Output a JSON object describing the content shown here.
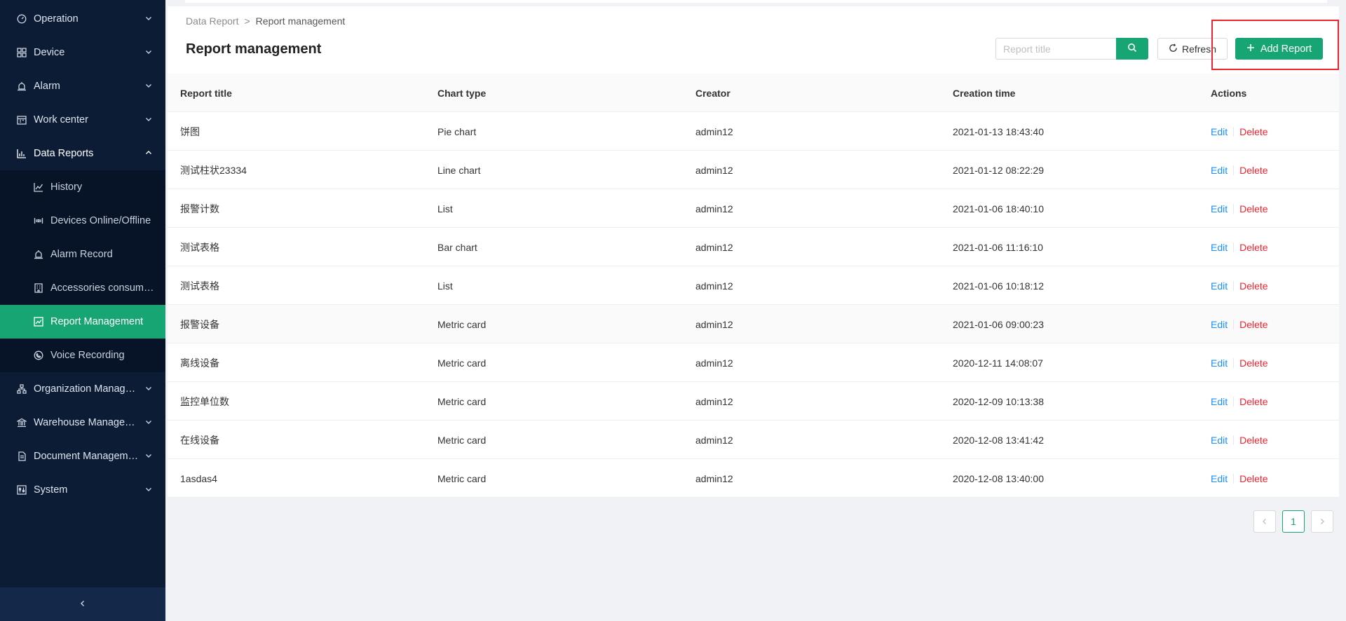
{
  "sidebar": {
    "items": [
      {
        "label": "Operation",
        "icon": "dashboard-icon"
      },
      {
        "label": "Device",
        "icon": "grid-icon"
      },
      {
        "label": "Alarm",
        "icon": "alarm-icon"
      },
      {
        "label": "Work center",
        "icon": "calendar-icon"
      },
      {
        "label": "Data Reports",
        "icon": "bar-chart-icon"
      },
      {
        "label": "History",
        "icon": "line-chart-icon"
      },
      {
        "label": "Devices Online/Offline",
        "icon": "signal-icon"
      },
      {
        "label": "Alarm Record",
        "icon": "alarm-icon"
      },
      {
        "label": "Accessories consumpt...",
        "icon": "building-icon"
      },
      {
        "label": "Report Management",
        "icon": "report-icon"
      },
      {
        "label": "Voice Recording",
        "icon": "phone-icon"
      },
      {
        "label": "Organization Manage...",
        "icon": "org-icon"
      },
      {
        "label": "Warehouse Manageme...",
        "icon": "bank-icon"
      },
      {
        "label": "Document Management",
        "icon": "document-icon"
      },
      {
        "label": "System",
        "icon": "settings-icon"
      }
    ]
  },
  "breadcrumb": {
    "parent": "Data Report",
    "separator": ">",
    "current": "Report management"
  },
  "page": {
    "title": "Report management"
  },
  "search": {
    "placeholder": "Report title",
    "value": ""
  },
  "toolbar": {
    "refresh_label": "Refresh",
    "add_label": "Add Report"
  },
  "table": {
    "columns": [
      "Report title",
      "Chart type",
      "Creator",
      "Creation time",
      "Actions"
    ],
    "rows": [
      {
        "title": "饼图",
        "type": "Pie chart",
        "creator": "admin12",
        "time": "2021-01-13 18:43:40"
      },
      {
        "title": "测试柱状23334",
        "type": "Line chart",
        "creator": "admin12",
        "time": "2021-01-12 08:22:29"
      },
      {
        "title": "报警计数",
        "type": "List",
        "creator": "admin12",
        "time": "2021-01-06 18:40:10"
      },
      {
        "title": "测试表格",
        "type": "Bar chart",
        "creator": "admin12",
        "time": "2021-01-06 11:16:10"
      },
      {
        "title": "测试表格",
        "type": "List",
        "creator": "admin12",
        "time": "2021-01-06 10:18:12"
      },
      {
        "title": "报警设备",
        "type": "Metric card",
        "creator": "admin12",
        "time": "2021-01-06 09:00:23"
      },
      {
        "title": "离线设备",
        "type": "Metric card",
        "creator": "admin12",
        "time": "2020-12-11 14:08:07"
      },
      {
        "title": "监控单位数",
        "type": "Metric card",
        "creator": "admin12",
        "time": "2020-12-09 10:13:38"
      },
      {
        "title": "在线设备",
        "type": "Metric card",
        "creator": "admin12",
        "time": "2020-12-08 13:41:42"
      },
      {
        "title": "1asdas4",
        "type": "Metric card",
        "creator": "admin12",
        "time": "2020-12-08 13:40:00"
      }
    ],
    "edit_label": "Edit",
    "delete_label": "Delete"
  },
  "pagination": {
    "current_page": "1",
    "prev_icon": "chevron-left-icon",
    "next_icon": "chevron-right-icon"
  },
  "colors": {
    "accent": "#17a673",
    "sidebar_bg": "#0c1c35",
    "link": "#1890ff",
    "danger": "#f5222d",
    "highlight": "#e8262c"
  }
}
